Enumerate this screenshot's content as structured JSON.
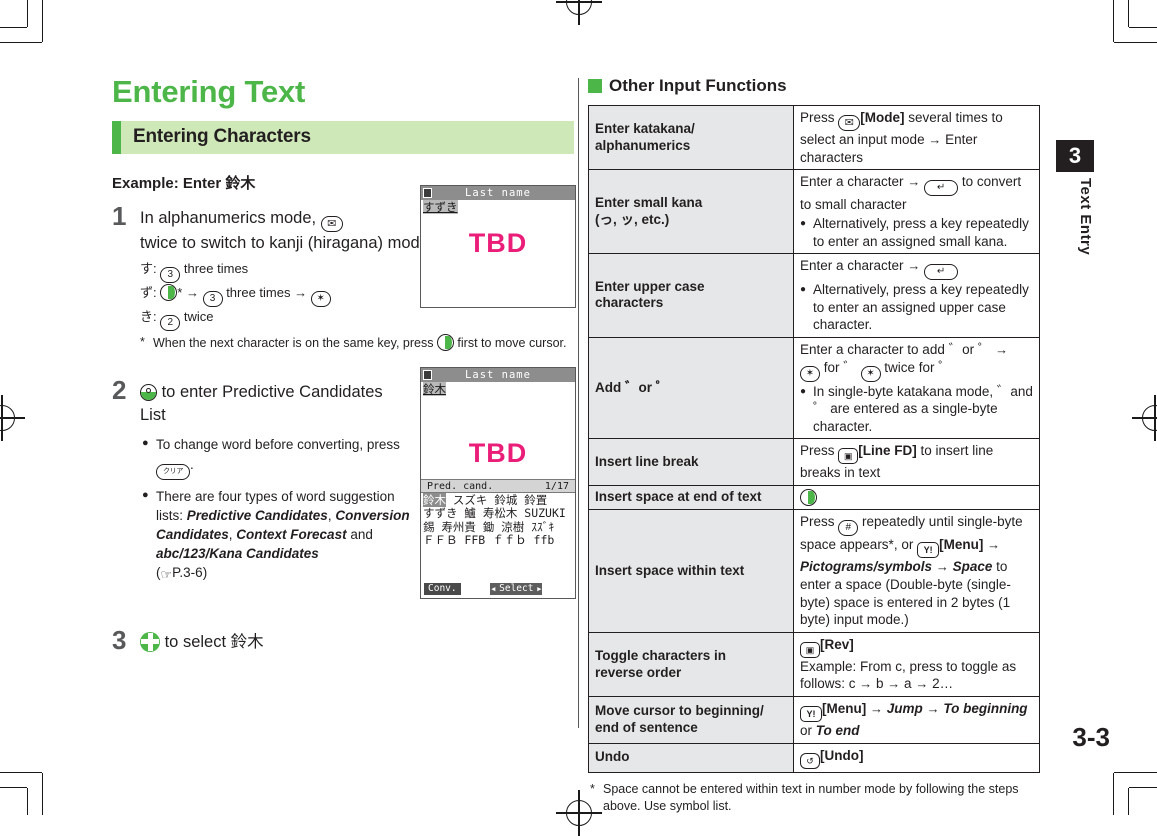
{
  "page": {
    "title": "Entering Text",
    "section": "Entering Characters",
    "example": "Example: Enter 鈴木",
    "number": "3-3",
    "chapter_number": "3",
    "chapter_name": "Text Entry"
  },
  "colors": {
    "accent_green": "#4CB648",
    "band_green": "#cfe8b8",
    "label_gray": "#e6e7e8",
    "tbd_magenta": "#ea1e79"
  },
  "steps": [
    {
      "num": "1",
      "text_before_key": "In alphanumerics mode,",
      "key": "mail-key",
      "text_after_key": "twice to switch to kanji (hiragana) mode",
      "sub_lines": [
        {
          "kana": "す:",
          "key": "3",
          "tail": "three times"
        },
        {
          "kana": "ず:",
          "key": "cursor-right",
          "tail": "* → 3 three times → *"
        },
        {
          "kana": "き:",
          "key": "2",
          "tail": "twice"
        }
      ],
      "footnote_marker": "*",
      "footnote": "When the next character is on the same key, press  first to move cursor."
    },
    {
      "num": "2",
      "key": "enter-key",
      "text": "to enter Predictive Candidates List",
      "bullets": [
        {
          "text_a": "To change word before converting, press",
          "key": "クリア／戻る",
          "text_b": "."
        },
        {
          "text_a": "There are four types of word suggestion lists:",
          "italics": [
            "Predictive Candidates",
            "Conversion Candidates",
            "Context Forecast",
            "abc/123/Kana Candidates"
          ],
          "joiner": "and",
          "ref": "P.3-6"
        }
      ]
    },
    {
      "num": "3",
      "key": "nav-key",
      "text": "to select 鈴木"
    }
  ],
  "phone_screens": [
    {
      "title": "Last name",
      "entry_plain": "すず",
      "entry_cursor": "き",
      "placeholder": "TBD"
    },
    {
      "title": "Last name",
      "entry_selected": "鈴木",
      "placeholder": "TBD",
      "cand_label": "Pred. cand.",
      "cand_count": "1/17",
      "candidates_rows": [
        [
          "鈴木",
          "スズキ",
          "鈴城",
          "鈴置"
        ],
        [
          "すずき",
          "鱸",
          "寿松木",
          "SUZUKI"
        ],
        [
          "錫",
          "寿州貴",
          "鋤",
          "涼樹",
          "ｽｽﾞｷ"
        ],
        [
          "ＦＦＢ",
          "FFB",
          "ｆｆｂ",
          "ffb"
        ]
      ],
      "softkey_left": "Conv.",
      "softkey_center": "Select"
    }
  ],
  "other_functions": {
    "heading": "Other Input Functions",
    "rows": [
      {
        "label": "Enter katakana/\nalphanumerics",
        "value_html": "Press [mail-key][Mode] several times to select an input mode → Enter characters",
        "value_lead": "Press",
        "key1": "mail-key",
        "bold1": "[Mode]",
        "rest": " several times to select an input mode → Enter characters",
        "bullets": []
      },
      {
        "label": "Enter small kana\n(っ, ッ, etc.)",
        "value_lead": "Enter a character →",
        "key1": "send-key",
        "rest": " to convert to small character",
        "bullets": [
          "Alternatively, press a key repeatedly to enter an assigned small kana."
        ]
      },
      {
        "label": "Enter upper case\ncharacters",
        "value_lead": "Enter a character →",
        "key1": "send-key",
        "rest": "",
        "bullets": [
          "Alternatively, press a key repeatedly to enter an assigned upper case character."
        ]
      },
      {
        "label": "Add ゛or ゜",
        "value_lead": "Enter a character to add ゛or ゜ →",
        "key1": "star-key",
        "mid": " for ゛",
        "key2": "star-key",
        "rest": " twice for ゜",
        "bullets": [
          "In single-byte katakana mode, ゛and ゜ are entered as a single-byte character."
        ]
      },
      {
        "label": "Insert line break",
        "value_lead": "Press",
        "key1": "camera-key",
        "bold1": "[Line FD]",
        "rest": " to insert line breaks in text",
        "bullets": []
      },
      {
        "label": "Insert space at end of text",
        "value_lead": "",
        "key1": "cursor-right",
        "rest": "",
        "bullets": []
      },
      {
        "label": "Insert space within text",
        "value_lead": "Press",
        "key1": "hash-key",
        "rest": " repeatedly until single-byte space appears*, or",
        "key2": "yahoo-key",
        "bold2": "[Menu]",
        "italic1": "Pictograms/symbols",
        "italic2": "Space",
        "tail": "to enter a space (Double-byte (single-byte) space is entered in 2 bytes (1 byte) input mode.)",
        "bullets": []
      },
      {
        "label": "Toggle characters in\nreverse order",
        "value_lead": "",
        "key1": "camera-key",
        "bold1": "[Rev]",
        "rest": "Example: From c, press to toggle as follows: c → b → a → 2…",
        "bullets": []
      },
      {
        "label": "Move cursor to beginning/\nend of sentence",
        "value_lead": "",
        "key1": "yahoo-key",
        "bold1": "[Menu]",
        "italic1": "Jump",
        "italic2": "To beginning",
        "tail": "or",
        "italic3": "To end",
        "bullets": []
      },
      {
        "label": "Undo",
        "value_lead": "",
        "key1": "undo-key",
        "bold1": "[Undo]",
        "rest": "",
        "bullets": []
      }
    ],
    "footnote_marker": "*",
    "footnote": "Space cannot be entered within text in number mode by following the steps above. Use symbol list."
  },
  "labels": {
    "key_3": "3",
    "key_2": "2",
    "key_star": "✶",
    "key_hash": "#",
    "key_mail": "✉",
    "key_clear": "クリア",
    "key_yahoo": "Y!",
    "key_camera": "▣",
    "key_undo": "↺",
    "arrow": "→",
    "bullet": "●",
    "ref_glyph": "☞",
    "three_times": "three times",
    "twice": "twice"
  }
}
